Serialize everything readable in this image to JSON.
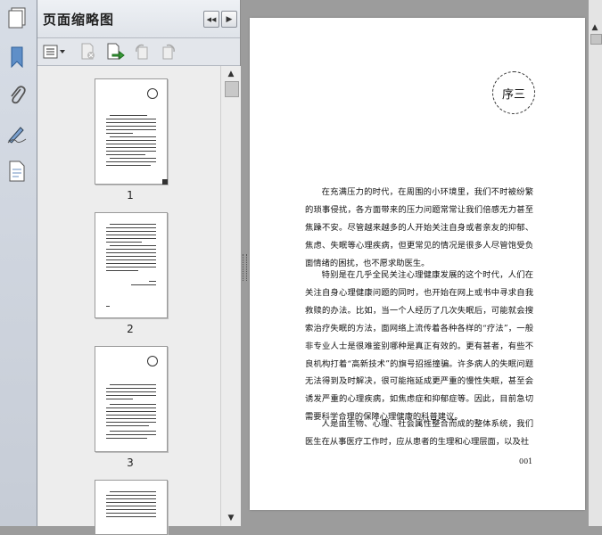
{
  "panel": {
    "title": "页面缩略图",
    "nav_prev": "◀◀",
    "nav_next": "▶"
  },
  "thumbnails": [
    {
      "label": "1"
    },
    {
      "label": "2"
    },
    {
      "label": "3"
    }
  ],
  "document": {
    "seal_text": "序三",
    "paragraphs": [
      "在充满压力的时代，在周围的小环境里，我们不时被纷繁的琐事侵扰，各方面带来的压力问题常常让我们倍感无力甚至焦躁不安。尽管越来越多的人开始关注自身或者亲友的抑郁、焦虑、失眠等心理疾病，但更常见的情况是很多人尽管饱受负面情绪的困扰，也不愿求助医生。",
      "特别是在几乎全民关注心理健康发展的这个时代，人们在关注自身心理健康问题的同时，也开始在网上或书中寻求自我救赎的办法。比如，当一个人经历了几次失眠后，可能就会搜索治疗失眠的方法，面网络上流传着各种各样的“疗法”，一般非专业人士是很难鉴别哪种是真正有效的。更有甚者，有些不良机构打着“高新技术”的旗号招摇撞骗。许多病人的失眠问题无法得到及时解决，很可能拖延成更严重的慢性失眠，甚至会诱发严重的心理疾病，如焦虑症和抑郁症等。因此，目前急切需要科学合理的保障心理健康的科普建议。",
      "人是由生物、心理、社会属性整合而成的整体系统，我们医生在从事医疗工作时，应从患者的生理和心理层面，以及社"
    ],
    "page_number": "001"
  }
}
